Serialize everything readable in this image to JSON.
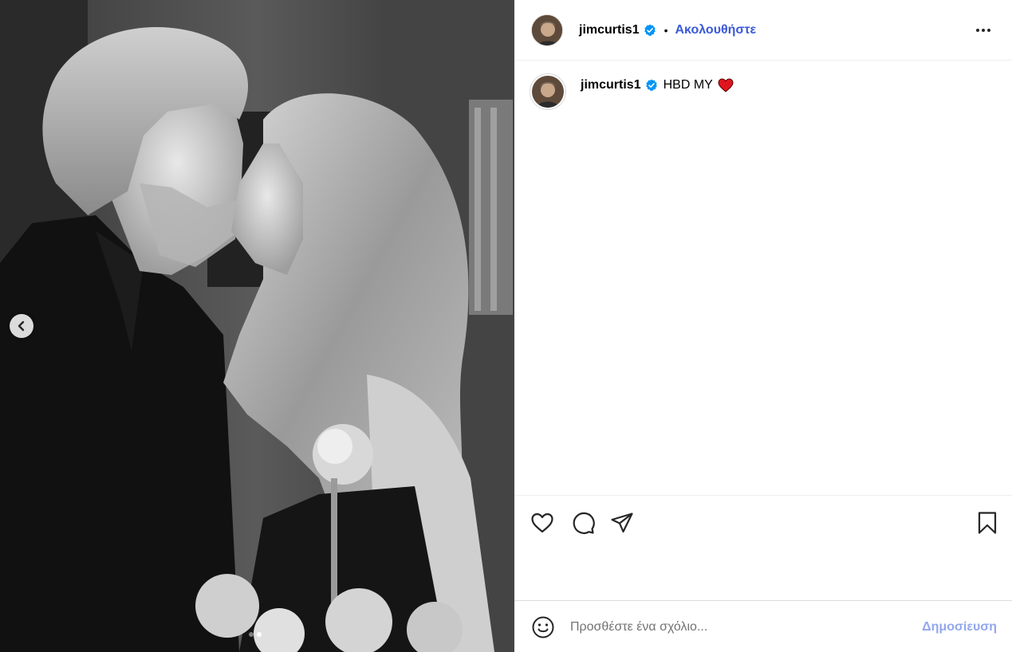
{
  "post": {
    "username": "jimcurtis1",
    "follow_label": "Ακολουθήστε",
    "separator": "•",
    "caption_user": "jimcurtis1",
    "caption_text": "HBD MY",
    "verified_icon": "verified-badge-icon",
    "caption_emoji": "red-heart-icon"
  },
  "media": {
    "image_description_icon": "photo",
    "carousel": {
      "count": 2,
      "active_index": 1
    }
  },
  "actions": {
    "like_icon": "heart-outline-icon",
    "comment_icon": "comment-bubble-icon",
    "share_icon": "paper-plane-icon",
    "save_icon": "bookmark-icon",
    "more_icon": "more-horizontal-icon"
  },
  "comment": {
    "placeholder": "Προσθέστε ένα σχόλιο...",
    "post_label": "Δημοσίευση"
  },
  "colors": {
    "accent": "#3a59d8",
    "verified": "#0095f6",
    "post_disabled": "#93a7ee",
    "heart": "#e0141e"
  }
}
